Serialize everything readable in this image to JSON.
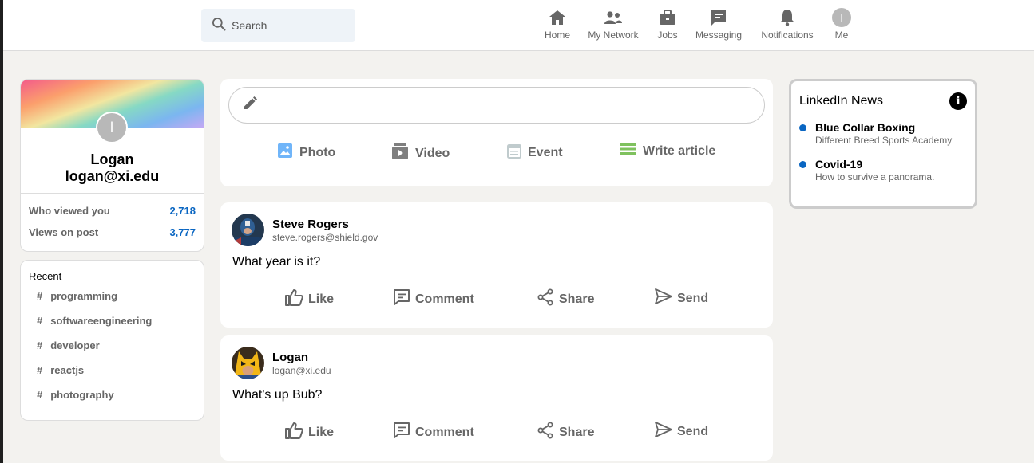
{
  "search": {
    "placeholder": "Search"
  },
  "nav": [
    {
      "label": "Home",
      "icon": "home-icon"
    },
    {
      "label": "My Network",
      "icon": "network-icon"
    },
    {
      "label": "Jobs",
      "icon": "briefcase-icon"
    },
    {
      "label": "Messaging",
      "icon": "message-icon"
    },
    {
      "label": "Notifications",
      "icon": "bell-icon"
    },
    {
      "label": "Me",
      "icon": "avatar",
      "initial": "l"
    }
  ],
  "profile": {
    "initial": "l",
    "name": "Logan",
    "email": "logan@xi.edu",
    "stats": [
      {
        "label": "Who viewed you",
        "value": "2,718"
      },
      {
        "label": "Views on post",
        "value": "3,777"
      }
    ]
  },
  "recent": {
    "title": "Recent",
    "tags": [
      "programming",
      "softwareengineering",
      "developer",
      "reactjs",
      "photography"
    ]
  },
  "composer": {
    "actions": [
      {
        "label": "Photo",
        "icon": "photo-icon",
        "color": "#70b5f9"
      },
      {
        "label": "Video",
        "icon": "video-icon",
        "color": "#7f7f7f"
      },
      {
        "label": "Event",
        "icon": "calendar-icon",
        "color": "#c0cbcd"
      },
      {
        "label": "Write article",
        "icon": "article-icon",
        "color": "#7fc15e"
      }
    ]
  },
  "posts": [
    {
      "name": "Steve Rogers",
      "email": "steve.rogers@shield.gov",
      "text": "What year is it?",
      "actions": [
        "Like",
        "Comment",
        "Share",
        "Send"
      ]
    },
    {
      "name": "Logan",
      "email": "logan@xi.edu",
      "text": "What's up Bub?",
      "actions": [
        "Like",
        "Comment",
        "Share",
        "Send"
      ]
    }
  ],
  "news": {
    "title": "LinkedIn News",
    "items": [
      {
        "headline": "Blue Collar Boxing",
        "sub": "Different Breed Sports Academy"
      },
      {
        "headline": "Covid-19",
        "sub": "How to survive a panorama."
      }
    ]
  },
  "colors": {
    "accent": "#0a66c2",
    "background": "#f3f2ef"
  }
}
